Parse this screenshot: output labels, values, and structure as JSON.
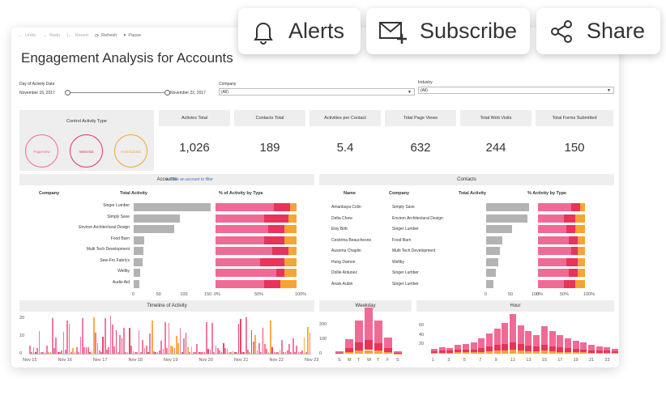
{
  "toolbar": {
    "undo": "Undo",
    "redo": "Redo",
    "revert": "Revert",
    "refresh": "Refresh",
    "pause": "Pause"
  },
  "actions": {
    "alerts": "Alerts",
    "subscribe": "Subscribe",
    "share": "Share"
  },
  "title": "Engagement Analysis for Accounts",
  "filters": {
    "date_label": "Day of Activity Date",
    "date_start": "November 15, 2017",
    "date_end": "November 22, 2017",
    "company_label": "Company",
    "company_value": "(All)",
    "industry_label": "Industry",
    "industry_value": "(All)"
  },
  "control": {
    "label": "Control Activity Type",
    "pageview": "PageView",
    "webvisit": "WebVisit",
    "formsubmit": "FormSubmit",
    "colors": {
      "pageview": "#f06a96",
      "webvisit": "#e8335a",
      "formsubmit": "#f5a534"
    }
  },
  "kpis": [
    {
      "label": "Activies Total",
      "value": "1,026"
    },
    {
      "label": "Contacts Total",
      "value": "189"
    },
    {
      "label": "Activities per Contact",
      "value": "5.4"
    },
    {
      "label": "Total Page Views",
      "value": "632"
    },
    {
      "label": "Total Web Visits",
      "value": "244"
    },
    {
      "label": "Total Forms Submitted",
      "value": "150"
    }
  ],
  "accounts": {
    "title": "Accounts",
    "filter_note": "★ Click an account to filter",
    "col_company": "Company",
    "col_total": "Total Activity",
    "col_pct": "% of Activity by Type",
    "rows": [
      {
        "name": "Singer Lumber",
        "total": 160,
        "pct": [
          72,
          20,
          8
        ]
      },
      {
        "name": "Simply Save",
        "total": 96,
        "pct": [
          60,
          30,
          10
        ]
      },
      {
        "name": "Environ Architectural Design",
        "total": 84,
        "pct": [
          65,
          20,
          15
        ]
      },
      {
        "name": "Food Barn",
        "total": 22,
        "pct": [
          60,
          25,
          15
        ]
      },
      {
        "name": "Multi Tech Development",
        "total": 20,
        "pct": [
          70,
          20,
          10
        ]
      },
      {
        "name": "Sew-Fro Fabrics",
        "total": 18,
        "pct": [
          55,
          30,
          15
        ]
      },
      {
        "name": "Wellby",
        "total": 14,
        "pct": [
          75,
          10,
          15
        ]
      },
      {
        "name": "Audio Aid",
        "total": 12,
        "pct": [
          60,
          20,
          20
        ]
      }
    ],
    "xticks": [
      "0",
      "50",
      "100",
      "150"
    ],
    "pticks": [
      "0%",
      "50%",
      "100%"
    ]
  },
  "contacts": {
    "title": "Contacts",
    "col_name": "Name",
    "col_company": "Company",
    "col_total": "Total Activity",
    "col_pct": "% Activity by Type",
    "rows": [
      {
        "name": "Amanbaya Colin",
        "company": "Simply Save",
        "total": 92,
        "pct": [
          70,
          20,
          10
        ]
      },
      {
        "name": "Delta Chew",
        "company": "Environ Architectural Design",
        "total": 88,
        "pct": [
          55,
          25,
          20
        ]
      },
      {
        "name": "Elsy Britt",
        "company": "Singer Lumber",
        "total": 55,
        "pct": [
          60,
          20,
          20
        ]
      },
      {
        "name": "Cesbrina Beauchesne",
        "company": "Food Barn",
        "total": 35,
        "pct": [
          65,
          20,
          15
        ]
      },
      {
        "name": "Ausoma Chaplin",
        "company": "Multi Tech Development",
        "total": 30,
        "pct": [
          70,
          15,
          15
        ]
      },
      {
        "name": "Hung Damon",
        "company": "Wellby",
        "total": 25,
        "pct": [
          60,
          25,
          15
        ]
      },
      {
        "name": "Dollie Antunez",
        "company": "Singer Lumber",
        "total": 20,
        "pct": [
          65,
          20,
          15
        ]
      },
      {
        "name": "Anais Aubin",
        "company": "Singer Lumber",
        "total": 15,
        "pct": [
          55,
          25,
          20
        ]
      }
    ],
    "xticks": [
      "0",
      "50",
      "100"
    ],
    "pticks": [
      "0%",
      "50%",
      "100%"
    ]
  },
  "timeline": {
    "title": "Timeline of Activity",
    "yticks": [
      "20",
      "10",
      "0"
    ],
    "xticks": [
      "Nov 15",
      "Nov 16",
      "Nov 17",
      "Nov 18",
      "Nov 19",
      "Nov 20",
      "Nov 21",
      "Nov 22",
      "Nov 23"
    ]
  },
  "weekday": {
    "title": "Weekday",
    "yticks": [
      "200",
      "100",
      "0"
    ],
    "xticks": [
      "S",
      "M",
      "T",
      "W",
      "T",
      "F",
      "S"
    ],
    "values": [
      [
        8,
        4,
        3
      ],
      [
        60,
        30,
        10
      ],
      [
        150,
        60,
        20
      ],
      [
        220,
        70,
        25
      ],
      [
        160,
        50,
        20
      ],
      [
        70,
        30,
        10
      ],
      [
        10,
        5,
        2
      ]
    ]
  },
  "hour": {
    "title": "Hour",
    "yticks": [
      "60",
      "40",
      "20"
    ],
    "xticks": [
      "1",
      "3",
      "5",
      "7",
      "9",
      "11",
      "13",
      "15",
      "17",
      "19",
      "21",
      "23"
    ],
    "values": [
      [
        5,
        3,
        2
      ],
      [
        8,
        4,
        2
      ],
      [
        6,
        4,
        2
      ],
      [
        10,
        5,
        3
      ],
      [
        12,
        6,
        3
      ],
      [
        14,
        6,
        3
      ],
      [
        20,
        8,
        4
      ],
      [
        28,
        10,
        5
      ],
      [
        35,
        12,
        6
      ],
      [
        45,
        14,
        6
      ],
      [
        60,
        16,
        8
      ],
      [
        40,
        14,
        6
      ],
      [
        30,
        12,
        5
      ],
      [
        25,
        10,
        5
      ],
      [
        40,
        12,
        6
      ],
      [
        32,
        10,
        5
      ],
      [
        26,
        9,
        4
      ],
      [
        20,
        8,
        4
      ],
      [
        18,
        7,
        3
      ],
      [
        15,
        6,
        3
      ],
      [
        12,
        5,
        2
      ],
      [
        10,
        4,
        2
      ],
      [
        8,
        4,
        2
      ],
      [
        6,
        3,
        2
      ]
    ]
  }
}
